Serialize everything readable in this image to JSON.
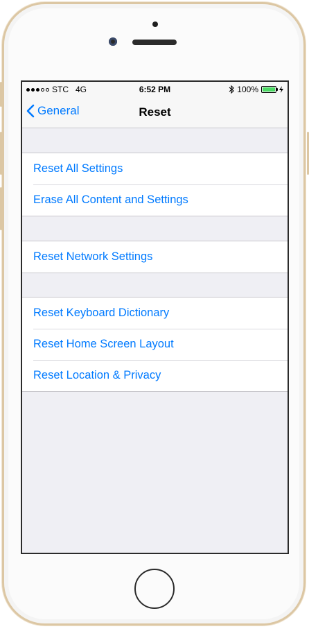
{
  "status_bar": {
    "carrier": "STC",
    "network": "4G",
    "time": "6:52 PM",
    "battery": "100%",
    "signal_strength": 3,
    "icons": [
      "signal-icon",
      "bluetooth-icon",
      "battery-icon",
      "charging-icon"
    ]
  },
  "nav": {
    "back_label": "General",
    "title": "Reset"
  },
  "groups": [
    {
      "items": [
        "Reset All Settings",
        "Erase All Content and Settings"
      ]
    },
    {
      "items": [
        "Reset Network Settings"
      ]
    },
    {
      "items": [
        "Reset Keyboard Dictionary",
        "Reset Home Screen Layout",
        "Reset Location & Privacy"
      ]
    }
  ],
  "colors": {
    "link": "#007aff",
    "background": "#efeff4",
    "separator": "#c8c7cc",
    "battery": "#4cd964",
    "device_trim": "#dcc7a4"
  }
}
